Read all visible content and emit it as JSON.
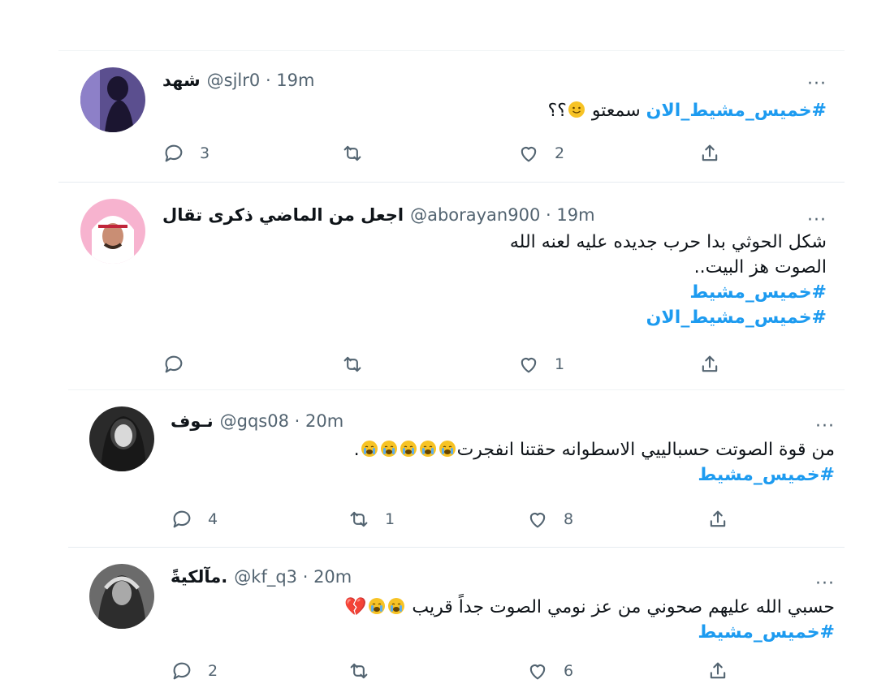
{
  "tweets": [
    {
      "name": "شهد",
      "handle": "@sjlr0",
      "time": "19m",
      "more": "···",
      "lines": [
        {
          "type": "mixed",
          "hashtag": "#خميس_مشيط_الان",
          "suffix": " سمعتو",
          "emojis": [
            "smile"
          ],
          "tail": "؟؟"
        }
      ],
      "replies": "3",
      "retweets": "",
      "likes": "2",
      "avatar_colors": [
        "#5a4a8a",
        "#9b8fd0"
      ]
    },
    {
      "name": "اجعل من الماضي ذكرى تقال",
      "handle": "@aborayan900",
      "time": "19m",
      "more": "···",
      "lines": [
        {
          "type": "text",
          "text": "شكل الحوثي بدا حرب جديده عليه لعنه الله"
        },
        {
          "type": "text",
          "text": "الصوت هز البيت.."
        },
        {
          "type": "hashtag",
          "text": "#خميس_مشيط"
        },
        {
          "type": "hashtag",
          "text": "#خميس_مشيط_الان"
        }
      ],
      "replies": "",
      "retweets": "",
      "likes": "1",
      "avatar_colors": [
        "#f4a3c4",
        "#ffffff"
      ]
    },
    {
      "name": "نـوف",
      "handle": "@gqs08",
      "time": "20m",
      "more": "···",
      "lines": [
        {
          "type": "emojitext",
          "text": "من قوة الصوتت حسبالييي الاسطوانه حقتنا انفجرت",
          "emojis": [
            "cry",
            "cry",
            "cry",
            "cry",
            "cry"
          ],
          "tail": "."
        },
        {
          "type": "hashtag",
          "text": "#خميس_مشيط"
        }
      ],
      "replies": "4",
      "retweets": "1",
      "likes": "8",
      "avatar_colors": [
        "#222222",
        "#777777"
      ]
    },
    {
      "name": "مآلكيةً.",
      "handle": "@kf_q3",
      "time": "20m",
      "more": "···",
      "lines": [
        {
          "type": "emojitext",
          "text": "حسبي الله عليهم صحوني من عز نومي الصوت جداً قريب",
          "emojis": [
            "cry",
            "cry",
            "heart"
          ],
          "tail": ""
        },
        {
          "type": "hashtag",
          "text": "#خميس_مشيط"
        }
      ],
      "replies": "2",
      "retweets": "",
      "likes": "6",
      "avatar_colors": [
        "#3a3a3a",
        "#9a9a9a"
      ]
    }
  ],
  "icons": {
    "reply": "reply-icon",
    "retweet": "retweet-icon",
    "like": "heart-icon",
    "share": "share-icon",
    "more": "more-icon"
  },
  "colors": {
    "hashtag": "#1d9bf0",
    "muted": "#536471",
    "text": "#0f1419",
    "divider": "#e6ecf0"
  }
}
